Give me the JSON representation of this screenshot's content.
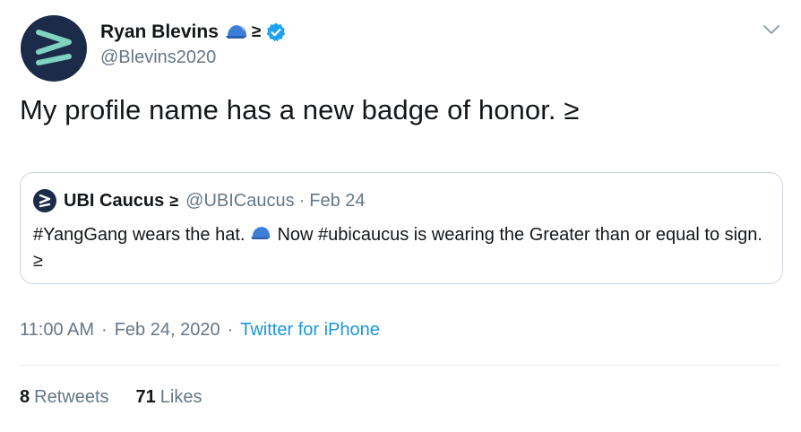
{
  "author": {
    "display_name": "Ryan Blevins",
    "name_suffix": "≥",
    "handle": "@Blevins2020",
    "avatar_icon": "greater-than-or-equal-logo",
    "verified_icon": "verified-badge-icon"
  },
  "tweet": {
    "text": "My profile name has a new badge of honor. ≥"
  },
  "quote": {
    "name": "UBI Caucus",
    "name_suffix": "≥",
    "handle": "@UBICaucus",
    "separator": "·",
    "date": "Feb 24",
    "text_part1": "#YangGang wears the hat.",
    "text_part2": "Now #ubicaucus is wearing the Greater than or equal to sign. ≥"
  },
  "meta": {
    "time": "11:00 AM",
    "dot1": "·",
    "date": "Feb 24, 2020",
    "dot2": "·",
    "source": "Twitter for iPhone"
  },
  "stats": {
    "retweets_count": "8",
    "retweets_label": "Retweets",
    "likes_count": "71",
    "likes_label": "Likes"
  },
  "colors": {
    "text": "#14171a",
    "secondary": "#657786",
    "link": "#1b95e0",
    "avatar_bg": "#1d2b4a",
    "logo_accent": "#7fd3c0",
    "border": "#ccd6dd"
  }
}
